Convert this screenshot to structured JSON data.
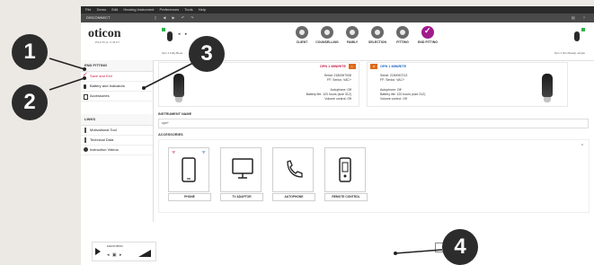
{
  "menubar": {
    "items": [
      "File",
      "Demo",
      "Edit",
      "Hearing Instrument",
      "Preferences",
      "Tools",
      "Help"
    ]
  },
  "toolbar": {
    "title": "DISCONNECT",
    "tools": "▯ ◀ ▶ ↶ ↷",
    "right": "▤ ?"
  },
  "header": {
    "logo": "oticon",
    "logo_sub": "PEOPLE FIRST",
    "left_side_label": "Opn 1 Fully Bene...",
    "right_side_label": "Opn 1 Non Ready, simple",
    "steps": [
      {
        "label": "CLIENT"
      },
      {
        "label": "COUNSELLING"
      },
      {
        "label": "FAMILY"
      },
      {
        "label": "SELECTION"
      },
      {
        "label": "FITTING"
      },
      {
        "label": "END FITTING"
      }
    ]
  },
  "sidebar": {
    "section_end_fitting": "END FITTING",
    "save_and_exit": "Save and Exit",
    "batteries": "Battery and Indicators",
    "accessories": "Accessories",
    "section_links": "LINKS",
    "motivational": "Motivational Tool",
    "technical": "Technical Data",
    "instruction": "Instruction Videos"
  },
  "left_panel": {
    "title": "OPN 1 MINIRITE",
    "badge": "L",
    "serial": "Serial: 2180067008",
    "fw": "FF: Senior, VAC+",
    "line1": "Autophone: Off",
    "line2": "Battery life: 120 hours (size 312)",
    "line3": "Volume control: Off"
  },
  "right_panel": {
    "title": "OPN 1 MINIRITE",
    "badge": "R",
    "serial": "Serial: 2180067213",
    "fw": "FF: Senior, VAC+",
    "line1": "Autophone: Off",
    "line2": "Battery life: 120 hours (size 312)",
    "line3": "Volume control: Off"
  },
  "instrument": {
    "label": "INSTRUMENT NAME",
    "value": "opn+"
  },
  "accessories": {
    "label": "ACCESSORIES",
    "items": [
      {
        "name": "PHONE",
        "icon": "phone-icon"
      },
      {
        "name": "TV ADAPTOR",
        "icon": "tv-icon"
      },
      {
        "name": "AUTOPHONE",
        "icon": "handset-icon"
      },
      {
        "name": "REMOTE CONTROL",
        "icon": "remote-icon"
      }
    ]
  },
  "save_button": "SAVE AND EXIT",
  "volume": {
    "label": "sound demo",
    "controls": "◂ ▣ ▸"
  },
  "callouts": [
    "1",
    "2",
    "3",
    "4"
  ],
  "colors": {
    "accent_magenta": "#a01a8a",
    "left_red": "#c6204a",
    "right_blue": "#1a66c4",
    "badge_orange": "#e06a1a",
    "callout_bg": "#2c2c2c"
  }
}
